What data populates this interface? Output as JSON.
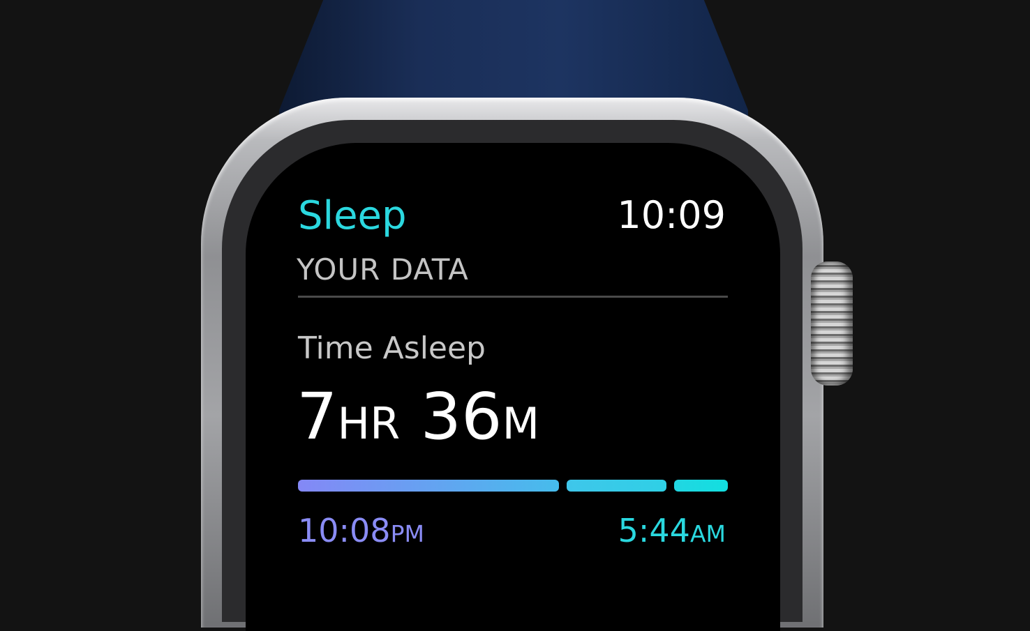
{
  "app": {
    "title": "Sleep",
    "clock": "10:09"
  },
  "section": {
    "heading": "YOUR DATA"
  },
  "metric": {
    "label": "Time Asleep",
    "hours": "7",
    "hours_unit": "HR",
    "minutes": "36",
    "minutes_unit": "M"
  },
  "timeline": {
    "segments": [
      {
        "fraction": 0.63,
        "from": "#8488f6",
        "to": "#46bcec"
      },
      {
        "fraction": 0.24,
        "from": "#3fc6ea",
        "to": "#2fd0e6"
      },
      {
        "fraction": 0.13,
        "from": "#22d6e2",
        "to": "#12dfe0"
      }
    ],
    "start_time": "10:08",
    "start_suffix": "PM",
    "end_time": "5:44",
    "end_suffix": "AM"
  }
}
